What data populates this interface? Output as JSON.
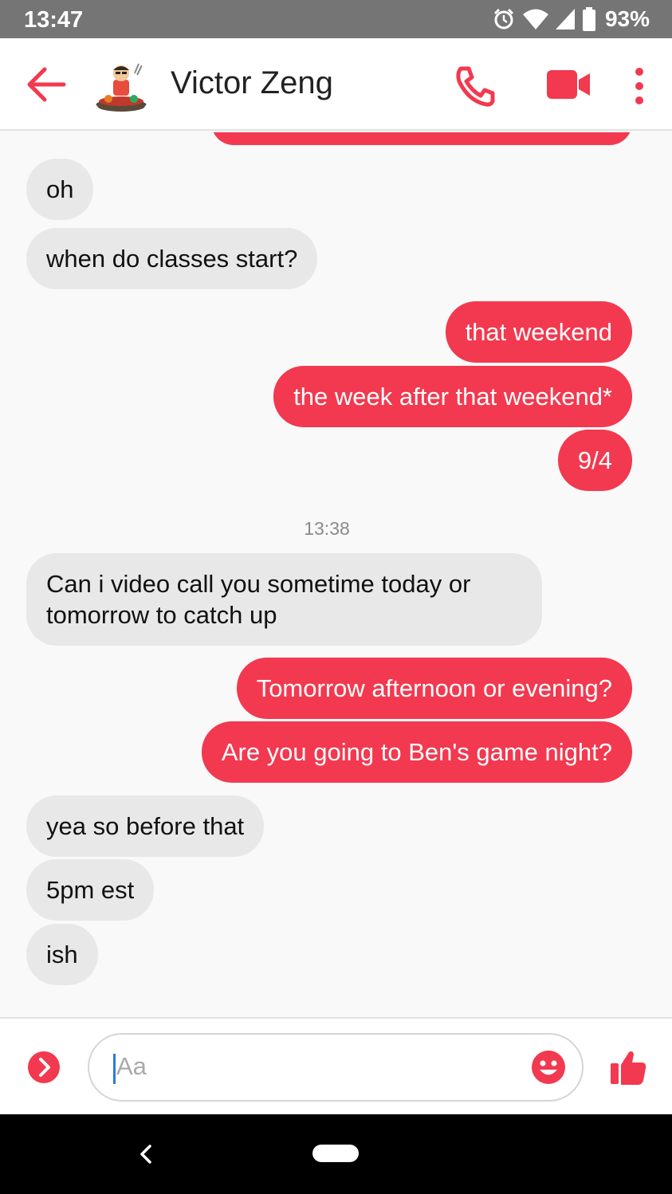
{
  "status_bar": {
    "time": "13:47",
    "battery": "93%",
    "icons": [
      "alarm-icon",
      "wifi-icon",
      "signal-icon",
      "battery-icon"
    ]
  },
  "header": {
    "contact_name": "Victor Zeng",
    "icons": [
      "back-arrow-icon",
      "phone-icon",
      "video-camera-icon",
      "more-vert-icon"
    ]
  },
  "messages": [
    {
      "from": "them",
      "text": "oh"
    },
    {
      "from": "them",
      "text": "when do classes start?"
    },
    {
      "from": "me",
      "text": "that weekend"
    },
    {
      "from": "me",
      "text": "the week after that weekend*"
    },
    {
      "from": "me",
      "text": "9/4"
    },
    {
      "timestamp": "13:38"
    },
    {
      "from": "them",
      "text": "Can i video call you sometime today or\ntomorrow to catch up"
    },
    {
      "from": "me",
      "text": "Tomorrow afternoon or evening?"
    },
    {
      "from": "me",
      "text": "Are you going to Ben's game night?"
    },
    {
      "from": "them",
      "text": "yea so before that"
    },
    {
      "from": "them",
      "text": "5pm est"
    },
    {
      "from": "them",
      "text": "ish"
    }
  ],
  "composer": {
    "placeholder": "Aa",
    "icons": [
      "expand-icon",
      "emoji-icon",
      "thumbs-up-icon"
    ]
  },
  "colors": {
    "accent": "#f2394f",
    "incoming_bubble": "#e8e8e8",
    "status_bar": "#757575"
  }
}
